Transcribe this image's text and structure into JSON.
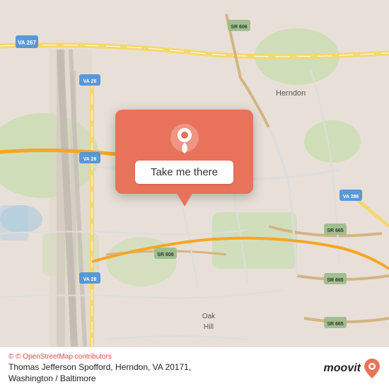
{
  "map": {
    "alt": "Map of Thomas Jefferson Spofford, Herndon, VA 20171",
    "center": {
      "lat": 38.93,
      "lng": -77.39
    }
  },
  "popup": {
    "icon_label": "location-pin",
    "button_label": "Take me there"
  },
  "bottom_bar": {
    "osm_credit": "© OpenStreetMap contributors",
    "address": "Thomas Jefferson Spofford, Herndon, VA 20171,",
    "address_line2": "Washington / Baltimore",
    "moovit_label": "moovit"
  }
}
